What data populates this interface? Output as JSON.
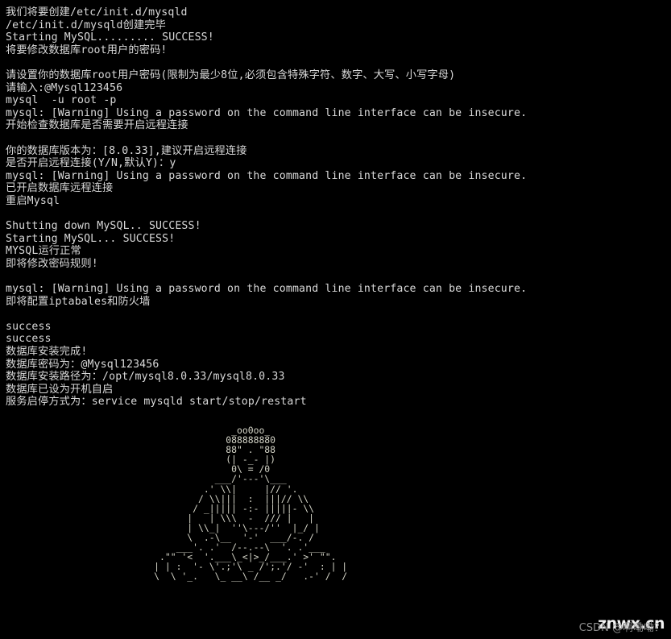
{
  "terminal": {
    "background_color": "#000000",
    "foreground_color": "#d9d9d9",
    "art_color": "#d5d5c8",
    "lines": [
      "我们将要创建/etc/init.d/mysqld",
      "/etc/init.d/mysqld创建完毕",
      "Starting MySQL......... SUCCESS!",
      "将要修改数据库root用户的密码!",
      "",
      "请设置你的数据库root用户密码(限制为最少8位,必须包含特殊字符、数字、大写、小写字母)",
      "请输入:@Mysql123456",
      "mysql  -u root -p",
      "mysql: [Warning] Using a password on the command line interface can be insecure.",
      "开始检查数据库是否需要开启远程连接",
      "",
      "你的数据库版本为：[8.0.33],建议开启远程连接",
      "是否开启远程连接(Y/N,默认Y)：y",
      "mysql: [Warning] Using a password on the command line interface can be insecure.",
      "已开启数据库远程连接",
      "重启Mysql",
      "",
      "Shutting down MySQL.. SUCCESS!",
      "Starting MySQL... SUCCESS!",
      "MYSQL运行正常",
      "即将修改密码规则!",
      "",
      "mysql: [Warning] Using a password on the command line interface can be insecure.",
      "即将配置iptabales和防火墙",
      "",
      "success",
      "success",
      "数据库安装完成!",
      "数据库密码为：@Mysql123456",
      "数据库安装路径为：/opt/mysql8.0.33/mysql8.0.33",
      "数据库已设为开机自启",
      "服务启停方式为：service mysqld start/stop/restart"
    ],
    "ascii_art_name": "buddha-blessing-ascii-art",
    "ascii_art": "                    _oo0oo_\n                   088888880\n                   88\" . \"88\n                   (| -_- |)\n                    0\\ = /0\n                 ___/'---'\\___\n               .' \\\\|     |// '.\n              / \\\\|||  :  |||// \\\\\n             / _||||| -:- |||||- \\\\\n            |   | \\\\\\  -  /// |   |\n            | \\\\_|  ''\\---/''  |_/ |\n            \\  .-\\__  '-'  ___/-. /\n          ___'. .'  /--.--\\  '. .'___\n       .\"\" '<  '.___\\_<|>_/___.' >' \"\".\n      | | :  '- \\'.;'\\ _ /';.'/ -'  : | |\n      \\  \\ '_.   \\_ __\\ /__ _/   .-' /  /"
  },
  "watermark": {
    "brand": "znwx.cn",
    "source": "CSDN @啊嘞嘞？"
  }
}
